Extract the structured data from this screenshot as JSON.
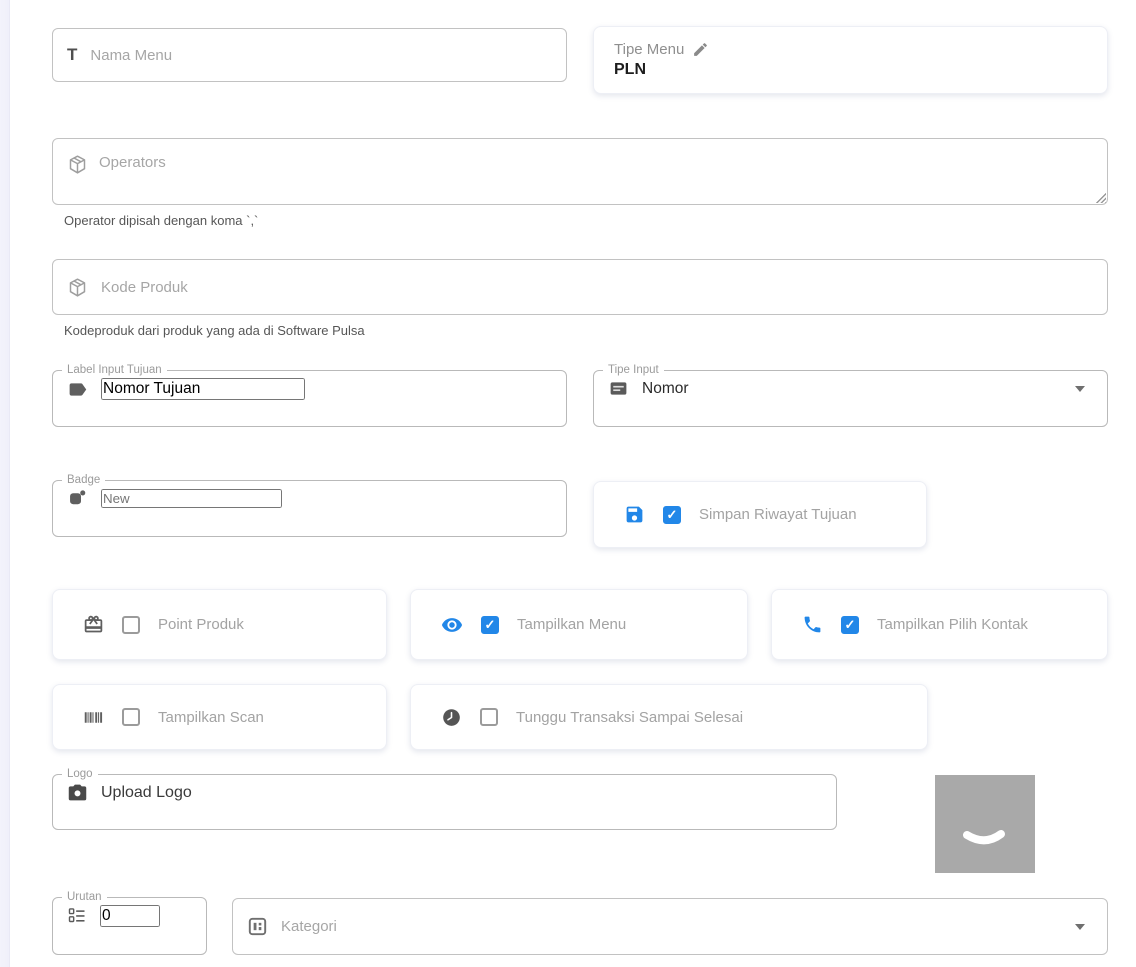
{
  "fields": {
    "nama_menu": {
      "placeholder": "Nama Menu"
    },
    "tipe_menu": {
      "label": "Tipe Menu",
      "value": "PLN"
    },
    "operators": {
      "placeholder": "Operators",
      "helper": "Operator dipisah dengan koma `,`"
    },
    "kode_produk": {
      "placeholder": "Kode Produk",
      "helper": "Kodeproduk dari produk yang ada di Software Pulsa"
    },
    "label_input_tujuan": {
      "label": "Label Input Tujuan",
      "value": "Nomor Tujuan"
    },
    "tipe_input": {
      "label": "Tipe Input",
      "value": "Nomor"
    },
    "badge": {
      "label": "Badge",
      "placeholder": "New"
    },
    "logo": {
      "label": "Logo",
      "button": "Upload Logo"
    },
    "urutan": {
      "label": "Urutan",
      "value": "0"
    },
    "kategori": {
      "placeholder": "Kategori"
    }
  },
  "toggles": {
    "simpan_riwayat": {
      "label": "Simpan Riwayat Tujuan",
      "checked": true
    },
    "point_produk": {
      "label": "Point Produk",
      "checked": false
    },
    "tampilkan_menu": {
      "label": "Tampilkan Menu",
      "checked": true
    },
    "pilih_kontak": {
      "label": "Tampilkan Pilih Kontak",
      "checked": true
    },
    "tampilkan_scan": {
      "label": "Tampilkan Scan",
      "checked": false
    },
    "tunggu_transaksi": {
      "label": "Tunggu Transaksi Sampai Selesai",
      "checked": false
    }
  },
  "icons": {
    "text": "text-icon",
    "pencil": "pencil-edit-icon",
    "package": "package-box-icon",
    "label": "label-tag-icon",
    "keypad": "numeric-keypad-icon",
    "badge": "badge-icon",
    "save": "save-icon",
    "gift": "gift-icon",
    "eye": "eye-icon",
    "phone": "phone-icon",
    "barcode": "barcode-icon",
    "clock": "clock-icon",
    "camera": "camera-icon",
    "ordered_list": "ordered-list-icon",
    "category": "category-icon",
    "caret": "chevron-down-icon"
  },
  "colors": {
    "accent_blue": "#2287e8",
    "icon_gray": "#5f5f5f",
    "placeholder_gray": "#a6a6a6",
    "strip": "#f3f3fb"
  }
}
